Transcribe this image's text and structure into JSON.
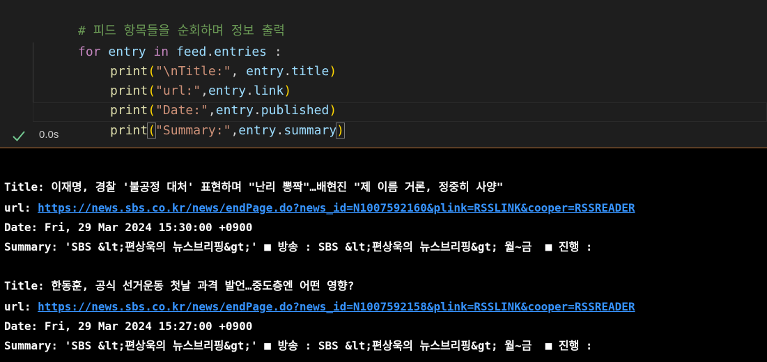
{
  "code": {
    "comment": "# 피드 항목들을 순회하며 정보 출력",
    "for_kw": "for",
    "for_var": "entry",
    "in_kw": "in",
    "iter_obj": "feed",
    "iter_attr": "entries",
    "for_tail": " :",
    "print_fn": "print",
    "line1_str": "\"\\nTitle:\"",
    "line1_attr": "title",
    "line2_str": "\"url:\"",
    "line2_attr": "link",
    "line3_str": "\"Date:\"",
    "line3_attr": "published",
    "line4_str": "\"Summary:\"",
    "line4_attr": "summary"
  },
  "status": {
    "duration": "0.0s",
    "icon": "check-icon",
    "color": "#73c991"
  },
  "output": {
    "title_label": "Title:",
    "url_label": "url:",
    "date_label": "Date:",
    "summary_label": "Summary:",
    "entries": [
      {
        "title": "이재명, 경찰 '불공정 대처' 표현하며 \"난리 뽕짝\"…배현진 \"제 이름 거론, 정중히 사양\"",
        "url": "https://news.sbs.co.kr/news/endPage.do?news_id=N1007592160&plink=RSSLINK&cooper=RSSREADER",
        "date": "Fri, 29 Mar 2024 15:30:00 +0900",
        "summary": "'SBS &lt;편상욱의 뉴스브리핑&gt;' ■ 방송 : SBS &lt;편상욱의 뉴스브리핑&gt; 월~금  ■ 진행 :"
      },
      {
        "title": "한동훈, 공식 선거운동 첫날 과격 발언…중도층엔 어떤 영향?",
        "url": "https://news.sbs.co.kr/news/endPage.do?news_id=N1007592158&plink=RSSLINK&cooper=RSSREADER",
        "date": "Fri, 29 Mar 2024 15:27:00 +0900",
        "summary": "'SBS &lt;편상욱의 뉴스브리핑&gt;' ■ 방송 : SBS &lt;편상욱의 뉴스브리핑&gt; 월~금  ■ 진행 :"
      }
    ]
  }
}
